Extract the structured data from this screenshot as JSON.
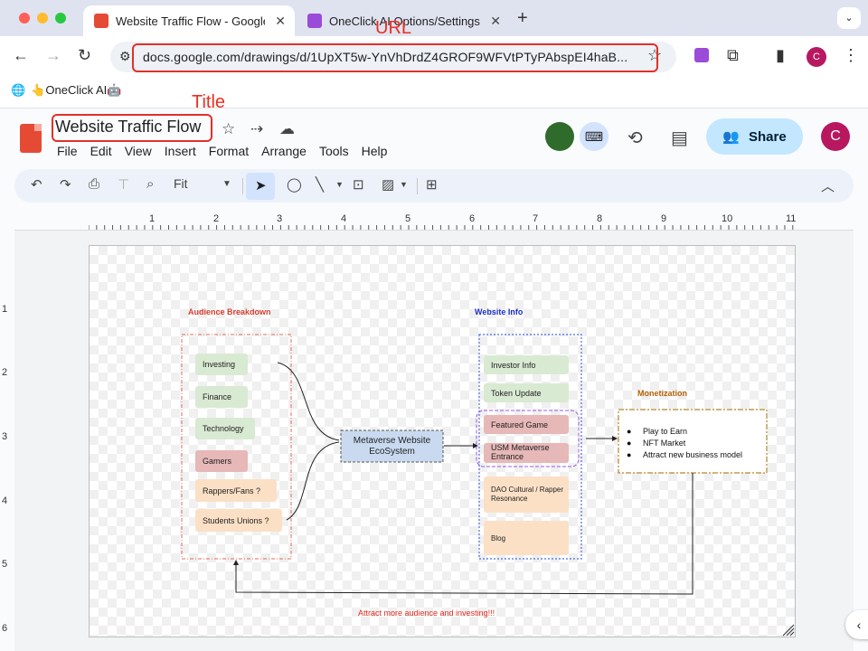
{
  "browser": {
    "tabs": [
      {
        "label": "Website Traffic Flow - Google Drawings",
        "active": true
      },
      {
        "label": "OneClick AI Options/Settings",
        "active": false
      }
    ],
    "url": "docs.google.com/drawings/d/1UpXT5w-YnVhDrdZ4GROF9WFVtPTyPAbspEI4haB...",
    "bookmark": "👆OneClick AI🤖",
    "profile_initial": "C"
  },
  "annotations": {
    "url_label": "URL",
    "title_label": "Title"
  },
  "app": {
    "title": "Website Traffic Flow",
    "menu": [
      "File",
      "Edit",
      "View",
      "Insert",
      "Format",
      "Arrange",
      "Tools",
      "Help"
    ],
    "share_label": "Share",
    "user_initial": "C",
    "zoom": "Fit"
  },
  "ruler": {
    "horizontal": [
      "1",
      "2",
      "3",
      "4",
      "5",
      "6",
      "7",
      "8",
      "9",
      "10",
      "11"
    ],
    "vertical": [
      "1",
      "2",
      "3",
      "4",
      "5",
      "6"
    ]
  },
  "diagram": {
    "audience": {
      "title": "Audience Breakdown",
      "items": [
        "Investing",
        "Finance",
        "Technology",
        "Gamers",
        "Rappers/Fans ?",
        "Students Unions ?"
      ]
    },
    "hub": "Metaverse Website EcoSystem",
    "website": {
      "title": "Website Info",
      "items": [
        "Investor Info",
        "Token Update",
        "Featured Game",
        "USM Metaverse Entrance",
        "DAO Cultural / Rapper Resonance",
        "Blog"
      ]
    },
    "monetization": {
      "title": "Monetization",
      "items": [
        "Play to Earn",
        "NFT Market",
        "Attract new business model"
      ]
    },
    "footer_note": "Attract more audience and investing!!!",
    "colors": {
      "audience_title": "#d63c2e",
      "website_title": "#1a2ccc",
      "monetization_title": "#b45f06",
      "footer_note": "#e02b20"
    }
  }
}
